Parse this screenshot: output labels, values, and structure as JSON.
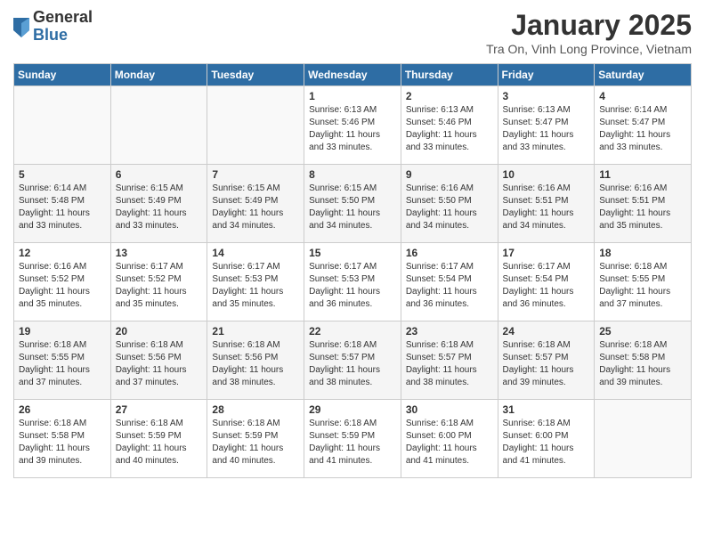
{
  "logo": {
    "general": "General",
    "blue": "Blue"
  },
  "title": "January 2025",
  "subtitle": "Tra On, Vinh Long Province, Vietnam",
  "header_days": [
    "Sunday",
    "Monday",
    "Tuesday",
    "Wednesday",
    "Thursday",
    "Friday",
    "Saturday"
  ],
  "weeks": [
    [
      {
        "day": "",
        "info": ""
      },
      {
        "day": "",
        "info": ""
      },
      {
        "day": "",
        "info": ""
      },
      {
        "day": "1",
        "info": "Sunrise: 6:13 AM\nSunset: 5:46 PM\nDaylight: 11 hours\nand 33 minutes."
      },
      {
        "day": "2",
        "info": "Sunrise: 6:13 AM\nSunset: 5:46 PM\nDaylight: 11 hours\nand 33 minutes."
      },
      {
        "day": "3",
        "info": "Sunrise: 6:13 AM\nSunset: 5:47 PM\nDaylight: 11 hours\nand 33 minutes."
      },
      {
        "day": "4",
        "info": "Sunrise: 6:14 AM\nSunset: 5:47 PM\nDaylight: 11 hours\nand 33 minutes."
      }
    ],
    [
      {
        "day": "5",
        "info": "Sunrise: 6:14 AM\nSunset: 5:48 PM\nDaylight: 11 hours\nand 33 minutes."
      },
      {
        "day": "6",
        "info": "Sunrise: 6:15 AM\nSunset: 5:49 PM\nDaylight: 11 hours\nand 33 minutes."
      },
      {
        "day": "7",
        "info": "Sunrise: 6:15 AM\nSunset: 5:49 PM\nDaylight: 11 hours\nand 34 minutes."
      },
      {
        "day": "8",
        "info": "Sunrise: 6:15 AM\nSunset: 5:50 PM\nDaylight: 11 hours\nand 34 minutes."
      },
      {
        "day": "9",
        "info": "Sunrise: 6:16 AM\nSunset: 5:50 PM\nDaylight: 11 hours\nand 34 minutes."
      },
      {
        "day": "10",
        "info": "Sunrise: 6:16 AM\nSunset: 5:51 PM\nDaylight: 11 hours\nand 34 minutes."
      },
      {
        "day": "11",
        "info": "Sunrise: 6:16 AM\nSunset: 5:51 PM\nDaylight: 11 hours\nand 35 minutes."
      }
    ],
    [
      {
        "day": "12",
        "info": "Sunrise: 6:16 AM\nSunset: 5:52 PM\nDaylight: 11 hours\nand 35 minutes."
      },
      {
        "day": "13",
        "info": "Sunrise: 6:17 AM\nSunset: 5:52 PM\nDaylight: 11 hours\nand 35 minutes."
      },
      {
        "day": "14",
        "info": "Sunrise: 6:17 AM\nSunset: 5:53 PM\nDaylight: 11 hours\nand 35 minutes."
      },
      {
        "day": "15",
        "info": "Sunrise: 6:17 AM\nSunset: 5:53 PM\nDaylight: 11 hours\nand 36 minutes."
      },
      {
        "day": "16",
        "info": "Sunrise: 6:17 AM\nSunset: 5:54 PM\nDaylight: 11 hours\nand 36 minutes."
      },
      {
        "day": "17",
        "info": "Sunrise: 6:17 AM\nSunset: 5:54 PM\nDaylight: 11 hours\nand 36 minutes."
      },
      {
        "day": "18",
        "info": "Sunrise: 6:18 AM\nSunset: 5:55 PM\nDaylight: 11 hours\nand 37 minutes."
      }
    ],
    [
      {
        "day": "19",
        "info": "Sunrise: 6:18 AM\nSunset: 5:55 PM\nDaylight: 11 hours\nand 37 minutes."
      },
      {
        "day": "20",
        "info": "Sunrise: 6:18 AM\nSunset: 5:56 PM\nDaylight: 11 hours\nand 37 minutes."
      },
      {
        "day": "21",
        "info": "Sunrise: 6:18 AM\nSunset: 5:56 PM\nDaylight: 11 hours\nand 38 minutes."
      },
      {
        "day": "22",
        "info": "Sunrise: 6:18 AM\nSunset: 5:57 PM\nDaylight: 11 hours\nand 38 minutes."
      },
      {
        "day": "23",
        "info": "Sunrise: 6:18 AM\nSunset: 5:57 PM\nDaylight: 11 hours\nand 38 minutes."
      },
      {
        "day": "24",
        "info": "Sunrise: 6:18 AM\nSunset: 5:57 PM\nDaylight: 11 hours\nand 39 minutes."
      },
      {
        "day": "25",
        "info": "Sunrise: 6:18 AM\nSunset: 5:58 PM\nDaylight: 11 hours\nand 39 minutes."
      }
    ],
    [
      {
        "day": "26",
        "info": "Sunrise: 6:18 AM\nSunset: 5:58 PM\nDaylight: 11 hours\nand 39 minutes."
      },
      {
        "day": "27",
        "info": "Sunrise: 6:18 AM\nSunset: 5:59 PM\nDaylight: 11 hours\nand 40 minutes."
      },
      {
        "day": "28",
        "info": "Sunrise: 6:18 AM\nSunset: 5:59 PM\nDaylight: 11 hours\nand 40 minutes."
      },
      {
        "day": "29",
        "info": "Sunrise: 6:18 AM\nSunset: 5:59 PM\nDaylight: 11 hours\nand 41 minutes."
      },
      {
        "day": "30",
        "info": "Sunrise: 6:18 AM\nSunset: 6:00 PM\nDaylight: 11 hours\nand 41 minutes."
      },
      {
        "day": "31",
        "info": "Sunrise: 6:18 AM\nSunset: 6:00 PM\nDaylight: 11 hours\nand 41 minutes."
      },
      {
        "day": "",
        "info": ""
      }
    ]
  ]
}
